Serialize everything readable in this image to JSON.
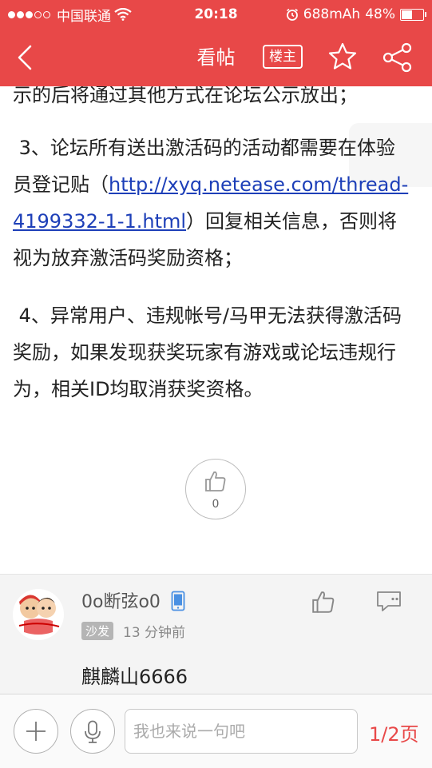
{
  "status": {
    "carrier": "中国联通",
    "time": "20:18",
    "battery_mah": "688mAh",
    "battery_pct": "48%",
    "battery_level": 0.48
  },
  "nav": {
    "title": "看帖",
    "louzhu_label": "楼主"
  },
  "post": {
    "cut_line": "示的后将通过其他方式在论坛公示放出；",
    "p3_text_before": "3、论坛所有送出激活码的活动都需要在体验员登记贴（",
    "p3_link": "http://xyq.netease.com/thread-4199332-1-1.html",
    "p3_text_after": "）回复相关信息，否则将视为放弃激活码奖励资格；",
    "p4_text": "4、异常用户、违规帐号/马甲无法获得激活码奖励，如果发现获奖玩家有游戏或论坛违规行为，相关ID均取消获奖资格。",
    "like_count": "0"
  },
  "reply": {
    "username": "0o断弦o0",
    "badge": "沙发",
    "time": "13 分钟前",
    "text": "麒麟山6666"
  },
  "bottom": {
    "input_placeholder": "我也来说一句吧",
    "page_indicator": "1/2页"
  },
  "colors": {
    "accent": "#e84848",
    "link": "#1d3fb8"
  }
}
